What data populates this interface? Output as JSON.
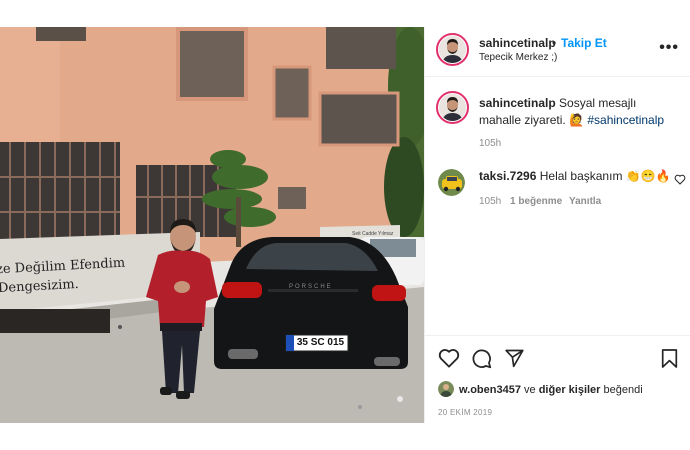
{
  "post": {
    "author": {
      "username": "sahincetinalp",
      "follow_label": "Takip Et",
      "separator": "•",
      "location": "Tepecik Merkez ;)"
    },
    "caption": {
      "username": "sahincetinalp",
      "text": "Sosyal mesajlı mahalle ziyareti.",
      "emoji": "🙋",
      "hashtag": "#sahincetinalp",
      "time": "105h"
    },
    "comments": [
      {
        "username": "taksi.7296",
        "text": "Helal başkanım",
        "emoji": "👏😁🔥",
        "time": "105h",
        "likes": "1 beğenme",
        "reply_label": "Yanıtla"
      }
    ],
    "photo": {
      "wall_text_1": "ze Değilim Efendim",
      "wall_text_2": "Dengesizim.",
      "plate": "35 SC 015",
      "brand": "PORSCHE",
      "wall_sign": "Seit Cadde Yılmaz"
    },
    "likes": {
      "first_user": "w.oben3457",
      "connector": "ve",
      "others": "diğer kişiler",
      "suffix": "beğendi"
    },
    "date": "20 EKİM 2019",
    "more_icon": "ellipsis-icon"
  },
  "colors": {
    "follow": "#0095f6",
    "hashtag": "#00376b",
    "ring": "#e1306c",
    "muted": "#8e8e8e"
  }
}
